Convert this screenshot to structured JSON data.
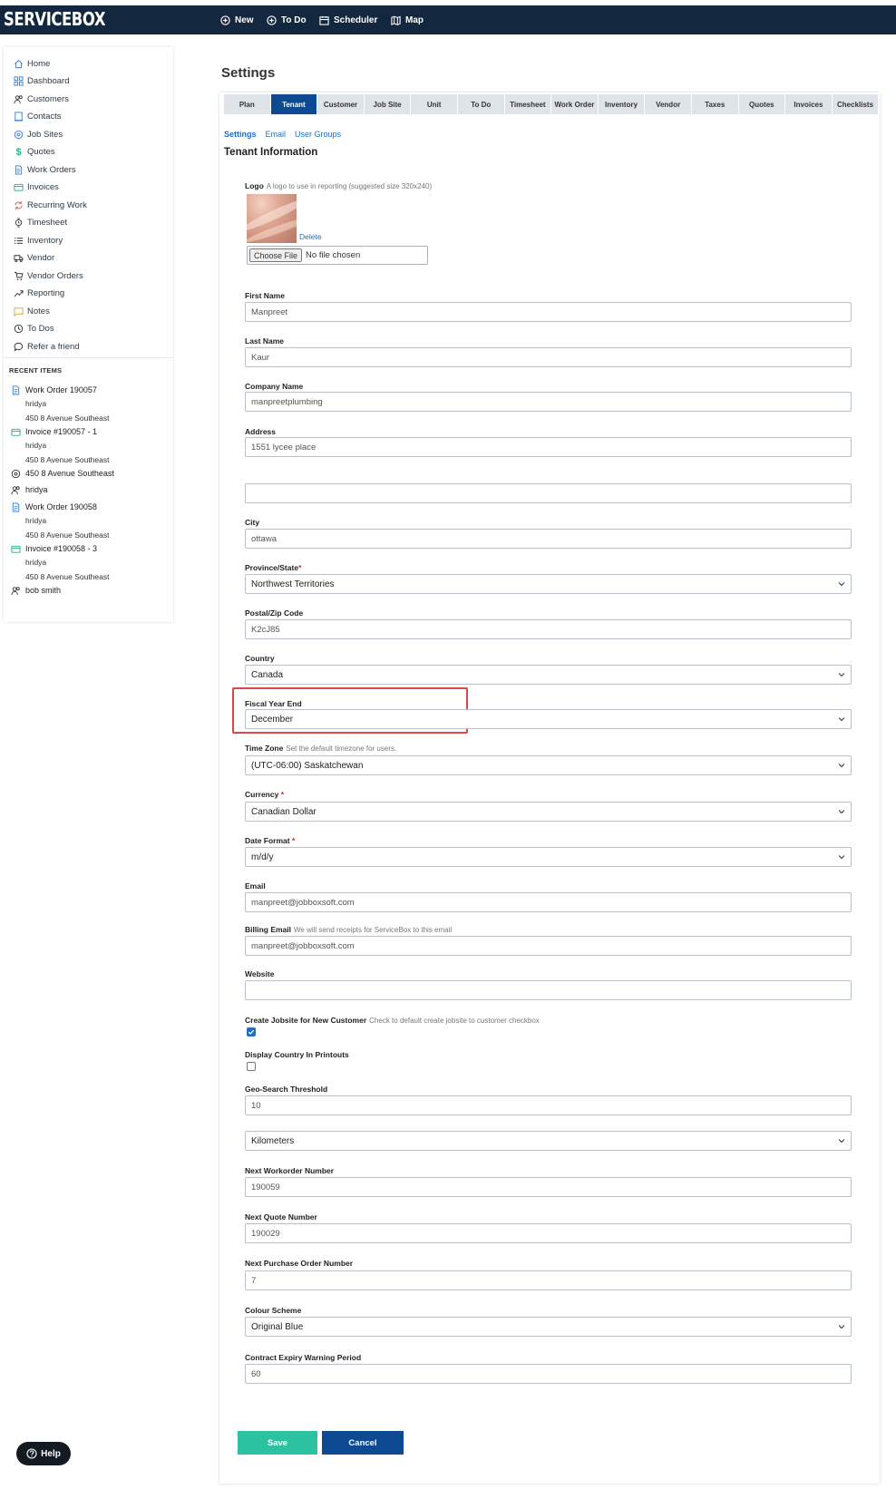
{
  "app": {
    "logo": "SERVICEBOX",
    "nav": [
      {
        "label": "New",
        "icon": "plus-circle-icon"
      },
      {
        "label": "To Do",
        "icon": "plus-circle-icon"
      },
      {
        "label": "Scheduler",
        "icon": "calendar-icon"
      },
      {
        "label": "Map",
        "icon": "map-icon"
      }
    ]
  },
  "sidebar": {
    "items": [
      {
        "label": "Home",
        "icon": "home-icon"
      },
      {
        "label": "Dashboard",
        "icon": "dashboard-icon"
      },
      {
        "label": "Customers",
        "icon": "customers-icon"
      },
      {
        "label": "Contacts",
        "icon": "contacts-icon"
      },
      {
        "label": "Job Sites",
        "icon": "location-icon"
      },
      {
        "label": "Quotes",
        "icon": "dollar-icon"
      },
      {
        "label": "Work Orders",
        "icon": "document-icon"
      },
      {
        "label": "Invoices",
        "icon": "invoice-icon"
      },
      {
        "label": "Recurring Work",
        "icon": "recurring-icon"
      },
      {
        "label": "Timesheet",
        "icon": "watch-icon"
      },
      {
        "label": "Inventory",
        "icon": "list-icon"
      },
      {
        "label": "Vendor",
        "icon": "truck-icon"
      },
      {
        "label": "Vendor Orders",
        "icon": "cart-icon"
      },
      {
        "label": "Reporting",
        "icon": "trend-icon"
      },
      {
        "label": "Notes",
        "icon": "note-icon"
      },
      {
        "label": "To Dos",
        "icon": "clock-icon"
      },
      {
        "label": "Refer a friend",
        "icon": "chat-icon"
      }
    ],
    "recent_title": "RECENT ITEMS",
    "recent": [
      {
        "title": "Work Order 190057",
        "icon": "document-icon",
        "subs": [
          "hridya",
          "450 8 Avenue Southeast"
        ]
      },
      {
        "title": "Invoice #190057 - 1",
        "icon": "invoice-icon",
        "subs": [
          "hridya",
          "450 8 Avenue Southeast"
        ]
      },
      {
        "title": "450 8 Avenue Southeast",
        "icon": "location-icon",
        "subs": []
      },
      {
        "title": "hridya",
        "icon": "user-icon",
        "subs": []
      },
      {
        "title": "Work Order 190058",
        "icon": "document-icon",
        "subs": [
          "hridya",
          "450 8 Avenue Southeast"
        ]
      },
      {
        "title": "Invoice #190058 - 3",
        "icon": "invoice-icon",
        "subs": [
          "hridya",
          "450 8 Avenue Southeast"
        ]
      },
      {
        "title": "bob smith",
        "icon": "user-icon",
        "subs": []
      }
    ]
  },
  "page": {
    "title": "Settings",
    "tabs": [
      "Plan",
      "Tenant",
      "Customer",
      "Job Site",
      "Unit",
      "To Do",
      "Timesheet",
      "Work Order",
      "Inventory",
      "Vendor",
      "Taxes",
      "Quotes",
      "Invoices",
      "Checklists"
    ],
    "active_tab": "Tenant",
    "subtabs": [
      "Settings",
      "Email",
      "User Groups"
    ],
    "section_title": "Tenant Information",
    "logo": {
      "label": "Logo",
      "help": "A logo to use in reporting (suggested size 320x240)",
      "delete": "Delete",
      "choose_file": "Choose File",
      "no_file": "No file chosen"
    },
    "fields": {
      "first_name": {
        "label": "First Name",
        "value": "Manpreet"
      },
      "last_name": {
        "label": "Last Name",
        "value": "Kaur"
      },
      "company_name": {
        "label": "Company Name",
        "value": "manpreetplumbing"
      },
      "address": {
        "label": "Address",
        "value": "1551 lycee place"
      },
      "address2": {
        "value": ""
      },
      "city": {
        "label": "City",
        "value": "ottawa"
      },
      "province": {
        "label": "Province/State",
        "value": "Northwest Territories"
      },
      "postal": {
        "label": "Postal/Zip Code",
        "value": "K2cJ85"
      },
      "country": {
        "label": "Country",
        "value": "Canada"
      },
      "fiscal": {
        "label": "Fiscal Year End",
        "value": "December"
      },
      "timezone": {
        "label": "Time Zone",
        "help": "Set the default timezone for users.",
        "value": "(UTC-06:00) Saskatchewan"
      },
      "currency": {
        "label": "Currency",
        "value": "Canadian Dollar"
      },
      "date_format": {
        "label": "Date Format",
        "value": "m/d/y"
      },
      "email": {
        "label": "Email",
        "value": "manpreet@jobboxsoft.com"
      },
      "billing_email": {
        "label": "Billing Email",
        "help": "We will send receipts for ServiceBox to this email",
        "value": "manpreet@jobboxsoft.com"
      },
      "website": {
        "label": "Website",
        "value": ""
      },
      "create_jobsite": {
        "label": "Create Jobsite for New Customer",
        "help": "Check to default create jobsite to customer checkbox",
        "checked": true
      },
      "display_country": {
        "label": "Display Country In Printouts",
        "checked": false
      },
      "geo_threshold": {
        "label": "Geo-Search Threshold",
        "value": "10"
      },
      "geo_unit": {
        "value": "Kilometers"
      },
      "next_workorder": {
        "label": "Next Workorder Number",
        "value": "190059"
      },
      "next_quote": {
        "label": "Next Quote Number",
        "value": "190029"
      },
      "next_po": {
        "label": "Next Purchase Order Number",
        "value": "7"
      },
      "colour_scheme": {
        "label": "Colour Scheme",
        "value": "Original Blue"
      },
      "contract_warning": {
        "label": "Contract Expiry Warning Period",
        "value": "60"
      }
    },
    "buttons": {
      "save": "Save",
      "cancel": "Cancel"
    },
    "help": "Help"
  },
  "colors": {
    "topbar": "#13283f",
    "active_tab": "#0d4a91",
    "save": "#2cc1a0",
    "cancel": "#0d4a91",
    "highlight": "#e04646",
    "link": "#1f6ecb"
  }
}
